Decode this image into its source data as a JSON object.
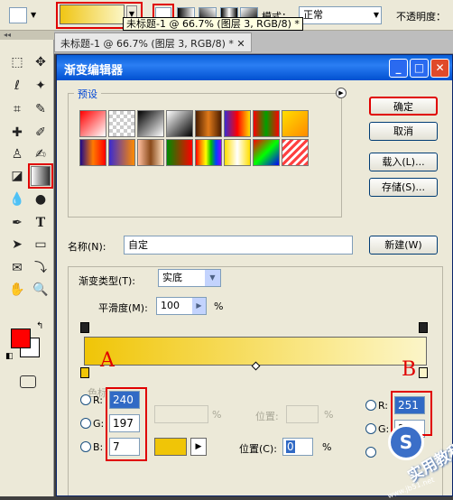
{
  "options_bar": {
    "tooltip": "未标题-1 @ 66.7% (图层 3, RGB/8) *",
    "mode_label": "模式：",
    "mode_value": "正常",
    "opacity_label": "不透明度："
  },
  "document_tab": "未标题-1 @ 66.7% (图层 3, RGB/8) *",
  "toolbox": {
    "tools": [
      "marquee-icon",
      "move-icon",
      "lasso-icon",
      "magic-wand-icon",
      "crop-icon",
      "eyedropper-icon",
      "healing-icon",
      "brush-icon",
      "stamp-icon",
      "history-brush-icon",
      "eraser-icon",
      "gradient-icon",
      "blur-icon",
      "dodge-icon",
      "pen-icon",
      "type-icon",
      "path-select-icon",
      "shape-icon",
      "notes-icon",
      "eyedropper2-icon",
      "hand-icon",
      "zoom-icon"
    ],
    "type_glyph": "T",
    "foreground_color": "#ff0000",
    "background_color": "#ffffff"
  },
  "dialog": {
    "title": "渐变编辑器",
    "presets_label": "预设",
    "buttons": {
      "ok": "确定",
      "cancel": "取消",
      "load": "载入(L)...",
      "save": "存储(S)...",
      "new": "新建(W)"
    },
    "name_label": "名称(N):",
    "name_value": "自定",
    "gradient_type_label": "渐变类型(T):",
    "gradient_type_value": "实底",
    "smoothness_label": "平滑度(M):",
    "smoothness_value": "100",
    "percent": "%",
    "stops_label": "色标",
    "stop_color_start": "#f0c507",
    "stop_color_end": "#fbf5c9",
    "left_color": {
      "r_label": "R:",
      "r": "240",
      "g_label": "G:",
      "g": "197",
      "b_label": "B:",
      "b": "7"
    },
    "right_color": {
      "r_label": "R:",
      "r": "251",
      "g_label": "G:",
      "g": "2"
    },
    "position_label": "位置:",
    "position_c_label": "位置(C):",
    "position_value": "0",
    "annotation_a": "A",
    "annotation_b": "B"
  },
  "watermark": {
    "letter": "S",
    "text": "实用教程",
    "sub": "www.jb51.net"
  }
}
